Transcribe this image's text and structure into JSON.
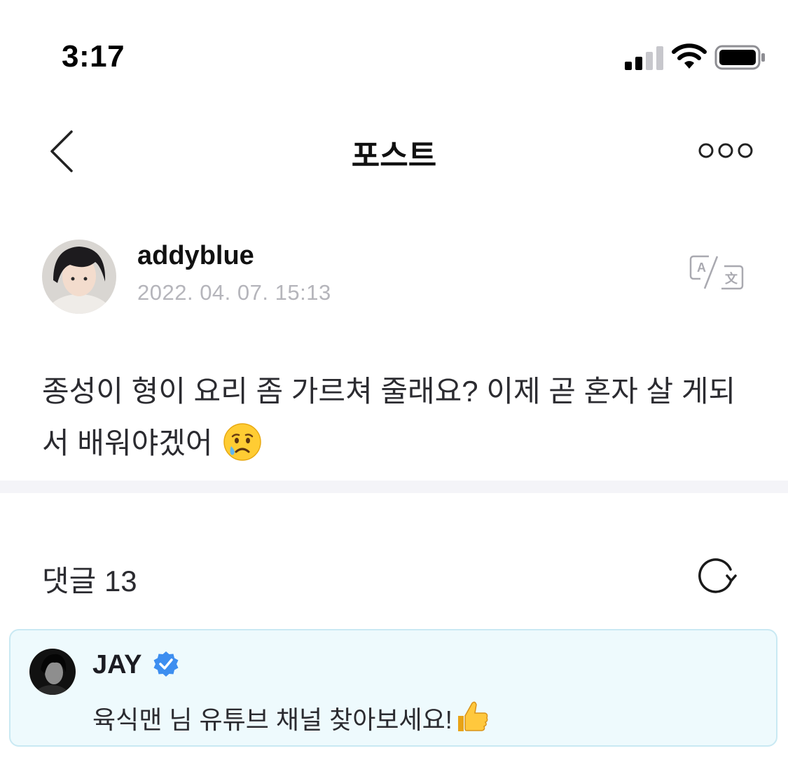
{
  "status_bar": {
    "time": "3:17"
  },
  "nav": {
    "title": "포스트"
  },
  "post": {
    "author": "addyblue",
    "date": "2022. 04. 07. 15:13",
    "body": "종성이 형이 요리 좀 가르쳐 줄래요? 이제 곧 혼자 살 게되서 배워야겠어",
    "emoji": "crying-face-emoji"
  },
  "comments": {
    "label": "댓글 13",
    "items": [
      {
        "author": "JAY",
        "verified": true,
        "text": "육식맨 님 유튜브 채널 찾아보세요!",
        "emoji": "thumbs-up-emoji"
      }
    ]
  },
  "colors": {
    "date_gray": "#b5b5bb",
    "divider": "#f4f4f8",
    "comment_bg": "#eefafd",
    "comment_border": "#c9e9f3",
    "verified_blue": "#3d8ef0"
  }
}
